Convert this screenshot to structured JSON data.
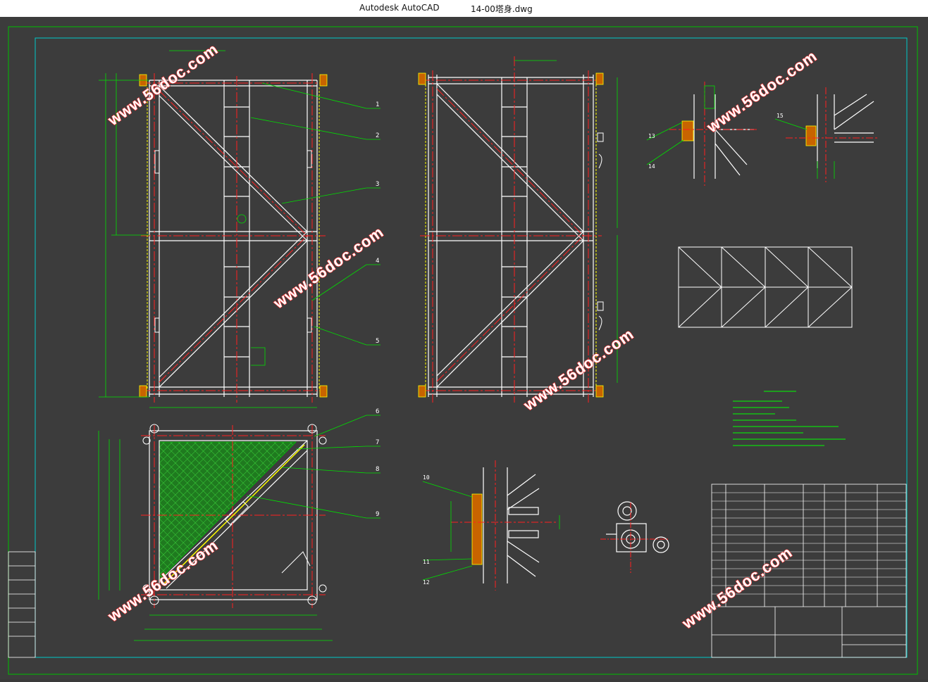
{
  "window": {
    "app_name": "Autodesk AutoCAD",
    "document_name": "14-00塔身.dwg"
  },
  "watermark": {
    "text": "www.56doc.com"
  },
  "callouts": [
    "1",
    "2",
    "3",
    "4",
    "5",
    "6",
    "7",
    "8",
    "9",
    "10",
    "11",
    "12",
    "13",
    "14",
    "15"
  ],
  "colors": {
    "background": "#3c3c3c",
    "frame_outer": "#00c000",
    "frame_inner": "#00c8c8",
    "member": "#ffffff",
    "centerline": "#ff2020",
    "dimension": "#00e000",
    "weld": "#ffff00",
    "hatch": "#00a000",
    "annotation": "#00ff00"
  }
}
